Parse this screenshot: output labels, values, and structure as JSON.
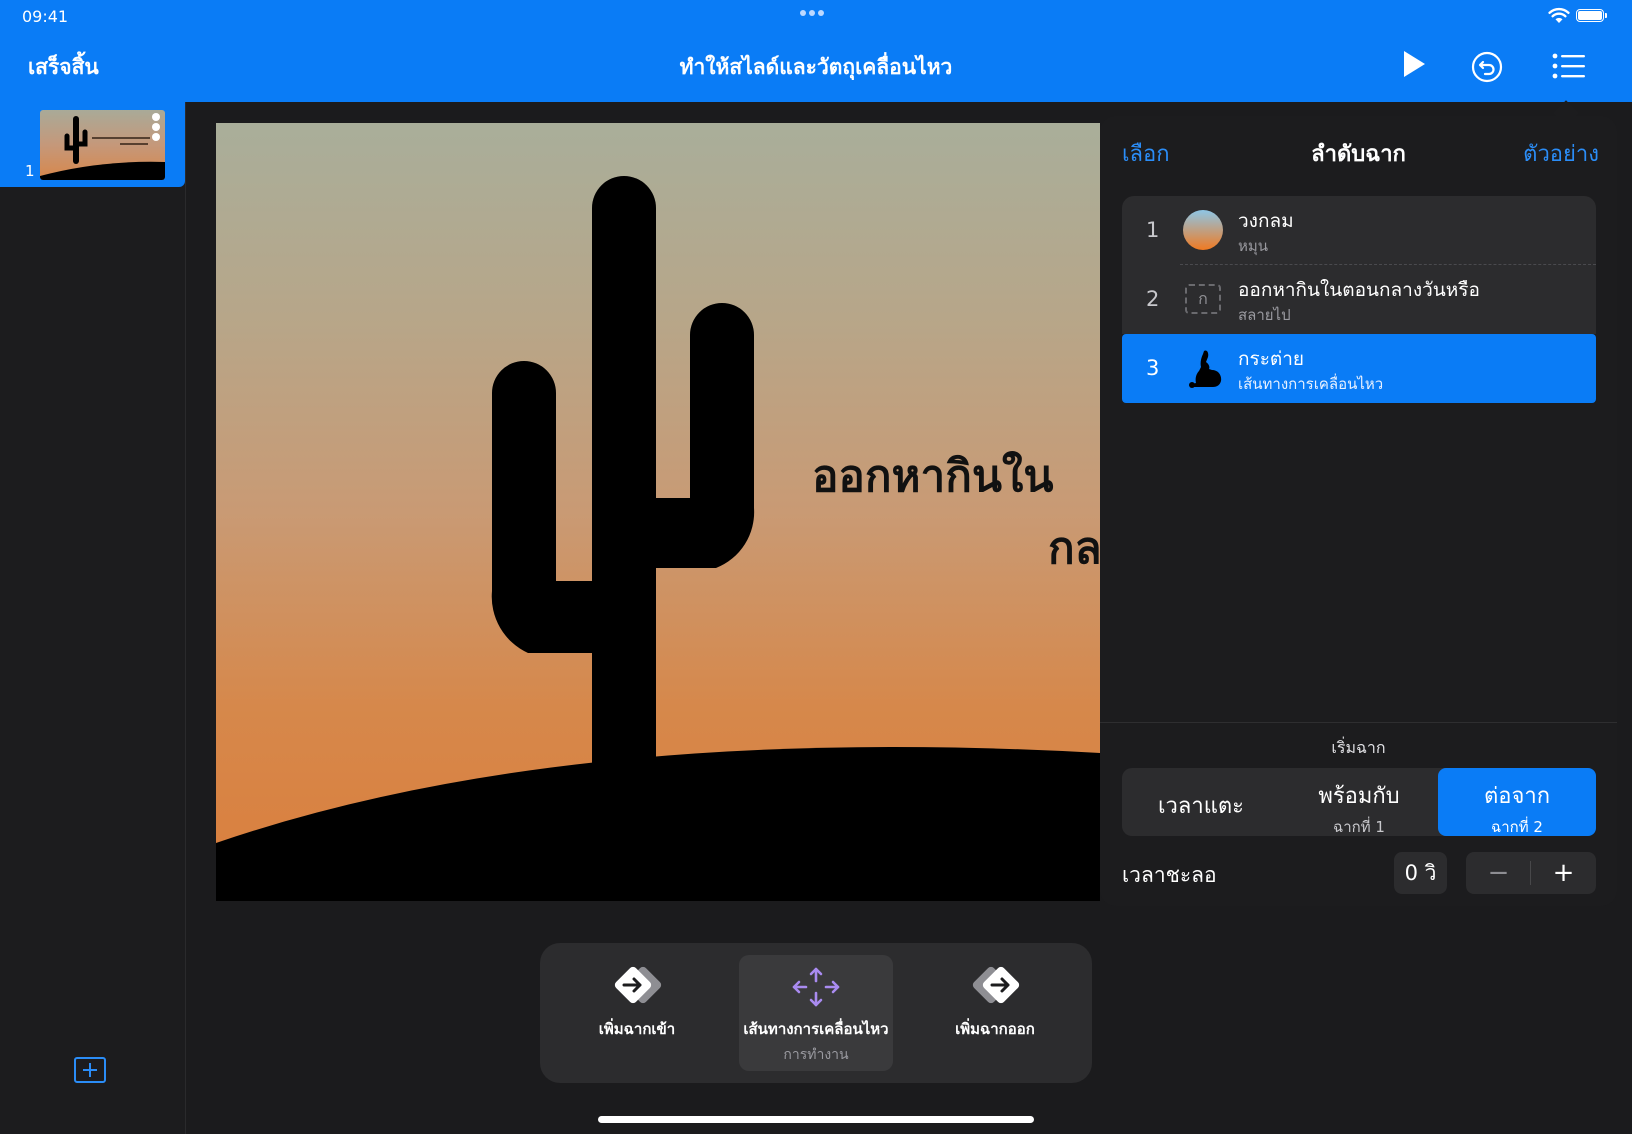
{
  "status": {
    "time": "09:41"
  },
  "header": {
    "done_label": "เสร็จสิ้น",
    "title": "ทำให้สไลด์และวัตถุเคลื่อนไหว"
  },
  "sidebar": {
    "slide_number": "1"
  },
  "slide": {
    "text_line1": "ออกหากินใน",
    "text_line2": "กล"
  },
  "panel": {
    "select_label": "เลือก",
    "title": "ลำดับฉาก",
    "preview_label": "ตัวอย่าง",
    "builds": [
      {
        "number": "1",
        "name": "วงกลม",
        "effect": "หมุน"
      },
      {
        "number": "2",
        "name": "ออกหากินในตอนกลางวันหรือ",
        "effect": "สลายไป",
        "thumb_glyph": "ก"
      },
      {
        "number": "3",
        "name": "กระต่าย",
        "effect": "เส้นทางการเคลื่อนไหว"
      }
    ],
    "start_label": "เริ่มฉาก",
    "start_options": [
      {
        "label": "เวลาแตะ",
        "sub": ""
      },
      {
        "label": "พร้อมกับ",
        "sub": "ฉากที่ 1"
      },
      {
        "label": "ต่อจาก",
        "sub": "ฉากที่ 2"
      }
    ],
    "selected_start": "ต่อจาก",
    "delay_label": "เวลาชะลอ",
    "delay_value": "0 วิ",
    "minus": "−",
    "plus": "+"
  },
  "toolbar": {
    "build_in": "เพิ่มฉากเข้า",
    "action": "เส้นทางการเคลื่อนไหว",
    "action_sub": "การทำงาน",
    "build_out": "เพิ่มฉากออก"
  },
  "colors": {
    "accent": "#0a7cf6",
    "panel_bg": "#1c1c1e",
    "row_bg": "#2c2c2e",
    "action_icon": "#a98bf0"
  }
}
